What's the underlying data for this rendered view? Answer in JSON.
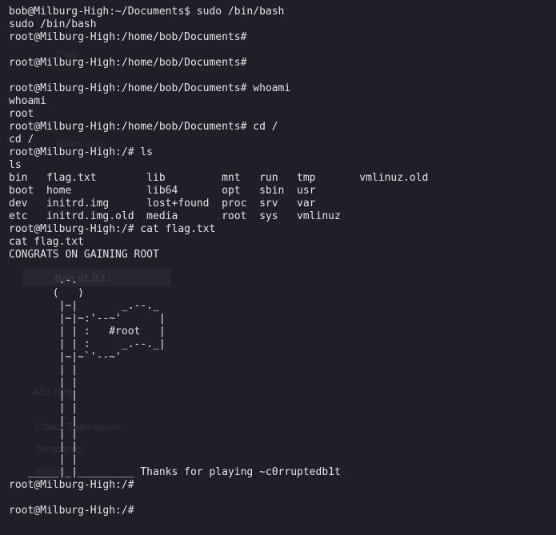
{
  "ghost_app": {
    "items": [
      "Duty",
      "Roles and ...",
      "Bob v1.0.1",
      "Add New",
      "Check Teamspace",
      "Templates",
      "Import"
    ]
  },
  "terminal": {
    "lines": [
      "bob@Milburg-High:~/Documents$ sudo /bin/bash",
      "sudo /bin/bash",
      "root@Milburg-High:/home/bob/Documents#",
      "",
      "root@Milburg-High:/home/bob/Documents#",
      "",
      "root@Milburg-High:/home/bob/Documents# whoami",
      "whoami",
      "root",
      "root@Milburg-High:/home/bob/Documents# cd /",
      "cd /",
      "root@Milburg-High:/# ls",
      "ls",
      "bin   flag.txt        lib         mnt   run   tmp       vmlinuz.old",
      "boot  home            lib64       opt   sbin  usr",
      "dev   initrd.img      lost+found  proc  srv   var",
      "etc   initrd.img.old  media       root  sys   vmlinuz",
      "root@Milburg-High:/# cat flag.txt",
      "cat flag.txt",
      "CONGRATS ON GAINING ROOT"
    ],
    "ascii_art": "\n        .-.\n       (   )\n        |~|       _.--._\n        |~|~:'--~'      |\n        | | :   #root   |\n        | | :     _.--._|\n        |~|~`'--~'\n        | |\n        | |\n        | |\n        | |\n        | |\n        | |\n        | |\n        | |\n   _____|_|_________ Thanks for playing ~c0rruptedb1t",
    "after_lines": [
      "root@Milburg-High:/#",
      "",
      "root@Milburg-High:/#"
    ]
  }
}
